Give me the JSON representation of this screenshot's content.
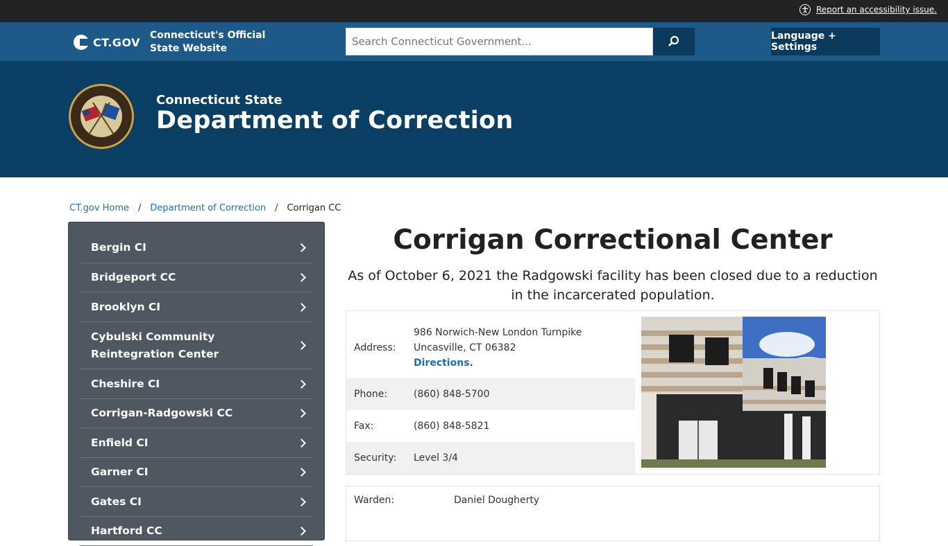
{
  "utility": {
    "accessibility_link": "Report an accessibility issue."
  },
  "ctgov": {
    "logo_text": "CT.GOV",
    "tagline": "Connecticut's Official State Website",
    "search_placeholder": "Search Connecticut Government...",
    "language_button": "Language + Settings"
  },
  "agency": {
    "kicker": "Connecticut State",
    "name": "Department of Correction",
    "seal_text": "CONNECTICUT DEPARTMENT OF CORRECTION"
  },
  "breadcrumb": {
    "items": [
      "CT.gov Home",
      "Department of Correction"
    ],
    "current": "Corrigan CC"
  },
  "sidebar": {
    "items": [
      "Bergin CI",
      "Bridgeport CC",
      "Brooklyn CI",
      "Cybulski Community Reintegration Center",
      "Cheshire CI",
      "Corrigan-Radgowski CC",
      "Enfield CI",
      "Garner CI",
      "Gates CI",
      "Hartford CC"
    ]
  },
  "main": {
    "title": "Corrigan Correctional Center",
    "notice": "As of October 6, 2021 the Radgowski facility has been closed due to a reduction in the incarcerated population.",
    "info": {
      "address_label": "Address:",
      "address_line1": "986 Norwich-New London Turnpike",
      "address_line2": "Uncasville, CT 06382",
      "directions": "Directions.",
      "phone_label": "Phone:",
      "phone": "(860) 848-5700",
      "fax_label": "Fax:",
      "fax": "(860) 848-5821",
      "security_label": "Security:",
      "security": "Level 3/4"
    },
    "warden": {
      "label": "Warden:",
      "name": "Daniel Dougherty"
    }
  },
  "colors": {
    "utility_bar": "#232323",
    "ctgov_header": "#1d5a8a",
    "agency_banner": "#0a3f63",
    "button_dark": "#0b3a5c",
    "sidebar": "#4f5760",
    "link": "#1a6fb0"
  }
}
